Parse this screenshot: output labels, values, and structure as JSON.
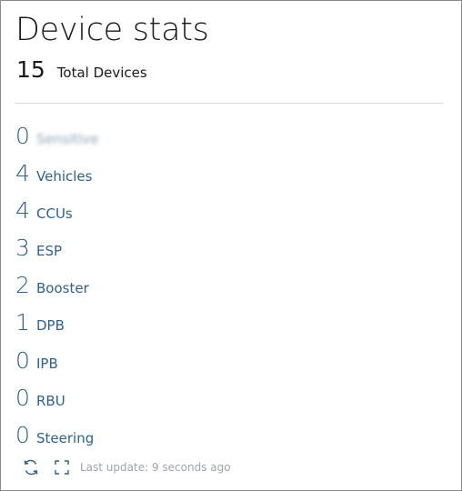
{
  "widget": {
    "title": "Device stats",
    "total_count": "15",
    "total_label": "Total Devices"
  },
  "stats": [
    {
      "count": "0",
      "label": "Sensitive",
      "redacted": true
    },
    {
      "count": "4",
      "label": "Vehicles"
    },
    {
      "count": "4",
      "label": "CCUs"
    },
    {
      "count": "3",
      "label": "ESP"
    },
    {
      "count": "2",
      "label": "Booster"
    },
    {
      "count": "1",
      "label": "DPB"
    },
    {
      "count": "0",
      "label": "IPB"
    },
    {
      "count": "0",
      "label": "RBU"
    },
    {
      "count": "0",
      "label": "Steering"
    }
  ],
  "footer": {
    "last_update": "Last update: 9 seconds ago",
    "refresh_icon": "refresh-icon",
    "fullscreen_icon": "fullscreen-icon"
  },
  "colors": {
    "link": "#2d6190",
    "muted": "#a0a4a8",
    "border": "#8a8a8a"
  }
}
